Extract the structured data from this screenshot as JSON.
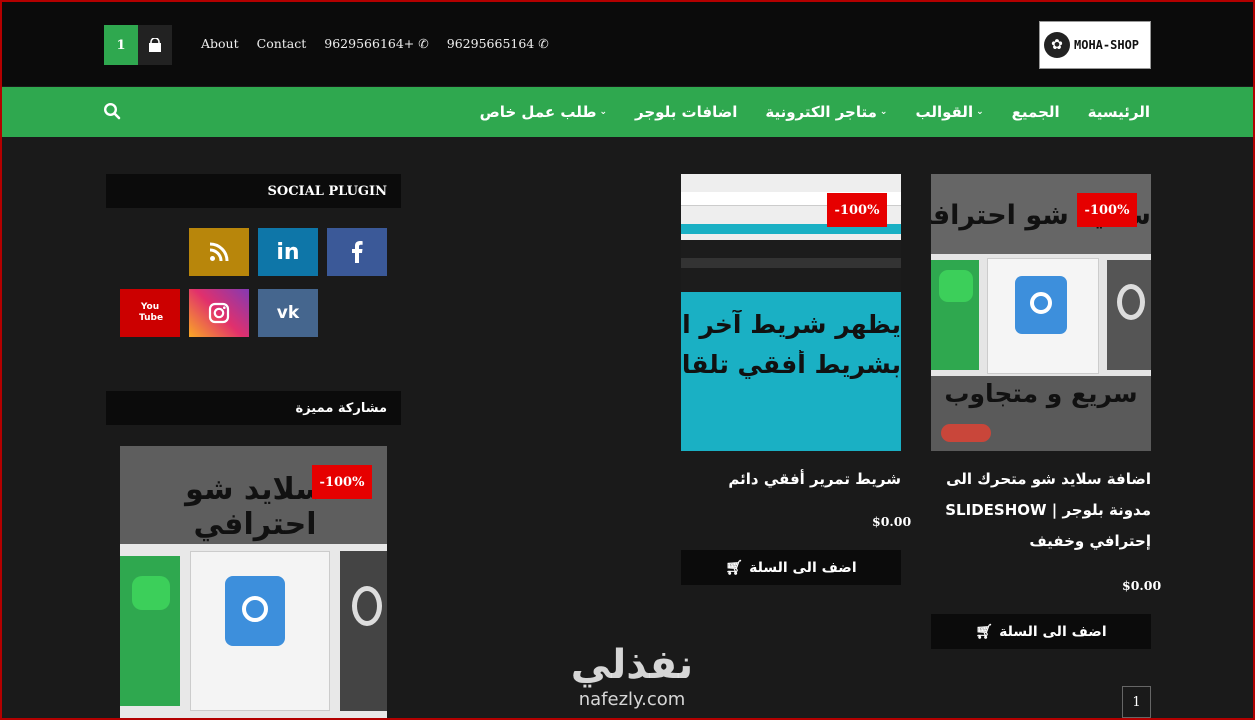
{
  "header": {
    "logo_text": "MOHA-SHOP",
    "cart_count": "1",
    "links": {
      "about": "About",
      "contact": "Contact"
    },
    "phone": "9629566164+",
    "whatsapp": "96295665164"
  },
  "nav": {
    "items": [
      "الرئيسية",
      "الجميع",
      "القوالب",
      "متاجر الكترونية",
      "اضافات بلوجر",
      "طلب عمل خاص"
    ]
  },
  "sidebar": {
    "social_title": "SOCIAL PLUGIN",
    "featured_title": "مشاركة مميزة",
    "featured_badge": "-100%",
    "social_icons": [
      "facebook-icon",
      "linkedin-icon",
      "rss-icon",
      "vk-icon",
      "instagram-icon",
      "youtube-icon"
    ],
    "youtube_text": "You Tube"
  },
  "products": [
    {
      "title": "اضافة سلايد شو متحرك الى مدونة بلوجر | SLIDESHOW إحترافي وخفيف",
      "price": "$0.00",
      "badge": "-100%",
      "button": "اضف الى السلة",
      "image_text": [
        "سلايد شو احترافي",
        "سريع و متجاوب"
      ]
    },
    {
      "title": "شريط تمرير أفقي دائم",
      "price": "$0.00",
      "badge": "-100%",
      "button": "اضف الى السلة",
      "image_text": [
        "يظهر شريط آخر الأخبا",
        "بشريط أفقي تلقائي لا نها"
      ]
    }
  ],
  "pagination": {
    "current": "1"
  },
  "watermark": {
    "arabic": "نفذلي",
    "latin": "nafezly.com"
  },
  "colors": {
    "accent": "#2fa84f",
    "badge": "#e60000",
    "dark": "#0b0b0b",
    "bg": "#1a1a1a"
  }
}
